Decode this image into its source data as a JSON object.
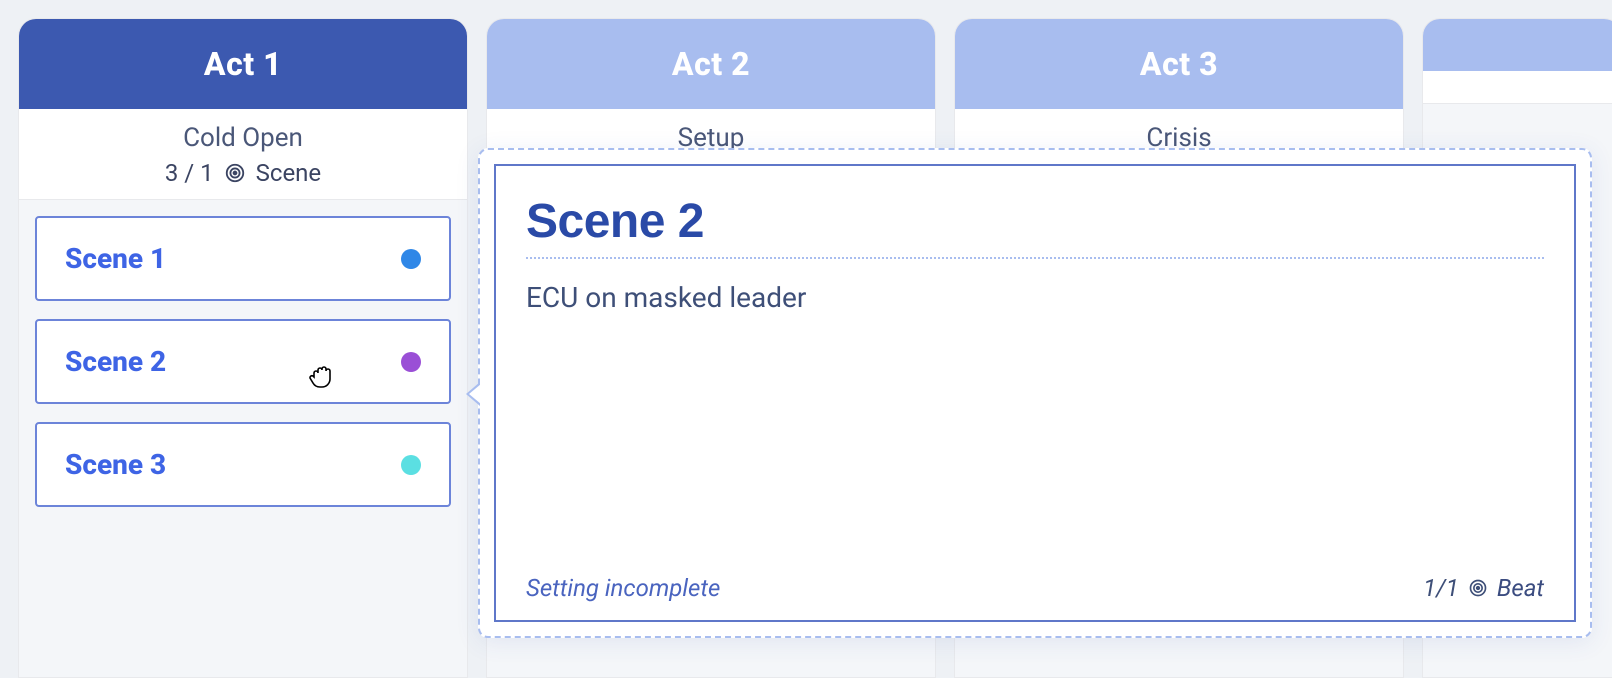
{
  "acts": [
    {
      "label": "Act 1",
      "active": true,
      "sub_title": "Cold Open",
      "count_text": "3 / 1",
      "count_unit": "Scene",
      "scenes": [
        {
          "label": "Scene 1",
          "dot_color": "#2f87e7"
        },
        {
          "label": "Scene 2",
          "dot_color": "#9a4fd6"
        },
        {
          "label": "Scene 3",
          "dot_color": "#5bdfe2"
        }
      ]
    },
    {
      "label": "Act 2",
      "active": false,
      "sub_title": "Setup"
    },
    {
      "label": "Act 3",
      "active": false,
      "sub_title": "Crisis"
    },
    {
      "label": "",
      "active": false,
      "sub_title": ""
    }
  ],
  "popover": {
    "title": "Scene 2",
    "description": "ECU on masked leader",
    "status": "Setting incomplete",
    "beat_count": "1/1",
    "beat_label": "Beat"
  }
}
